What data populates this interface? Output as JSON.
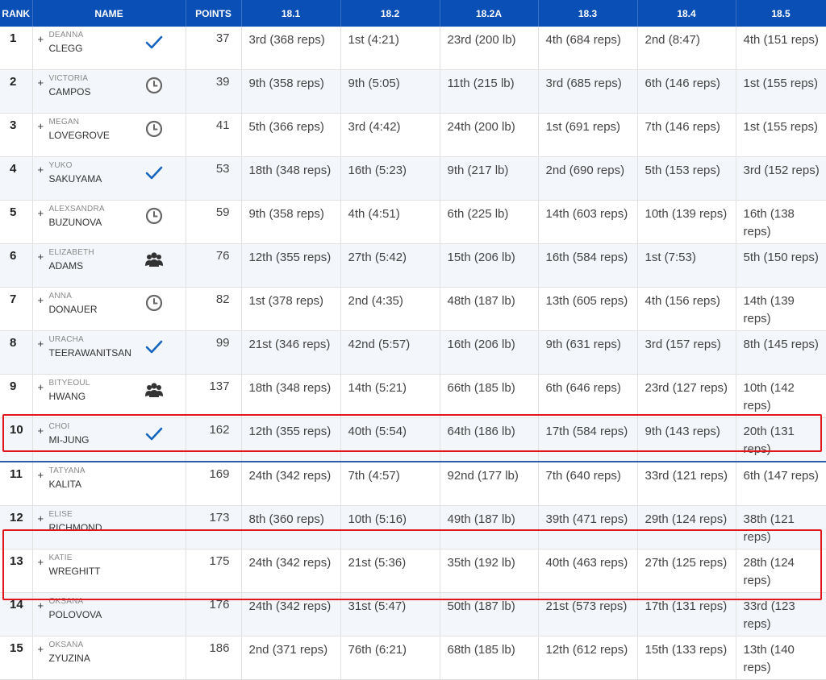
{
  "columns": {
    "rank": "RANK",
    "name": "NAME",
    "points": "POINTS",
    "e1": "18.1",
    "e2": "18.2",
    "e3": "18.2A",
    "e4": "18.3",
    "e5": "18.4",
    "e6": "18.5"
  },
  "colors": {
    "header_bg": "#0a4fb5",
    "highlight": "#e0161d",
    "icon_blue": "#1565c0"
  },
  "rows": [
    {
      "rank": "1",
      "first": "DEANNA",
      "last": "CLEGG",
      "status": "check-icon",
      "points": "37",
      "e1": "3rd (368 reps)",
      "e2": "1st (4:21)",
      "e3": "23rd (200 lb)",
      "e4": "4th (684 reps)",
      "e5": "2nd (8:47)",
      "e6": "4th (151 reps)"
    },
    {
      "rank": "2",
      "first": "VICTORIA",
      "last": "CAMPOS",
      "status": "clock-icon",
      "points": "39",
      "e1": "9th (358 reps)",
      "e2": "9th (5:05)",
      "e3": "11th (215 lb)",
      "e4": "3rd (685 reps)",
      "e5": "6th (146 reps)",
      "e6": "1st (155 reps)"
    },
    {
      "rank": "3",
      "first": "MEGAN",
      "last": "LOVEGROVE",
      "status": "clock-icon",
      "points": "41",
      "e1": "5th (366 reps)",
      "e2": "3rd (4:42)",
      "e3": "24th (200 lb)",
      "e4": "1st (691 reps)",
      "e5": "7th (146 reps)",
      "e6": "1st (155 reps)"
    },
    {
      "rank": "4",
      "first": "YUKO",
      "last": "SAKUYAMA",
      "status": "check-icon",
      "points": "53",
      "e1": "18th (348 reps)",
      "e2": "16th (5:23)",
      "e3": "9th (217 lb)",
      "e4": "2nd (690 reps)",
      "e5": "5th (153 reps)",
      "e6": "3rd (152 reps)"
    },
    {
      "rank": "5",
      "first": "ALEXSANDRA",
      "last": "BUZUNOVA",
      "status": "clock-icon",
      "points": "59",
      "e1": "9th (358 reps)",
      "e2": "4th (4:51)",
      "e3": "6th (225 lb)",
      "e4": "14th (603 reps)",
      "e5": "10th (139 reps)",
      "e6": "16th (138 reps)"
    },
    {
      "rank": "6",
      "first": "ELIZABETH",
      "last": "ADAMS",
      "status": "team-icon",
      "points": "76",
      "e1": "12th (355 reps)",
      "e2": "27th (5:42)",
      "e3": "15th (206 lb)",
      "e4": "16th (584 reps)",
      "e5": "1st (7:53)",
      "e6": "5th (150 reps)"
    },
    {
      "rank": "7",
      "first": "ANNA",
      "last": "DONAUER",
      "status": "clock-icon",
      "points": "82",
      "e1": "1st (378 reps)",
      "e2": "2nd (4:35)",
      "e3": "48th (187 lb)",
      "e4": "13th (605 reps)",
      "e5": "4th (156 reps)",
      "e6": "14th (139 reps)"
    },
    {
      "rank": "8",
      "first": "URACHA",
      "last": "TEERAWANITSAN",
      "status": "check-icon",
      "points": "99",
      "e1": "21st (346 reps)",
      "e2": "42nd (5:57)",
      "e3": "16th (206 lb)",
      "e4": "9th (631 reps)",
      "e5": "3rd (157 reps)",
      "e6": "8th (145 reps)"
    },
    {
      "rank": "9",
      "first": "BITYEOUL",
      "last": "HWANG",
      "status": "team-icon",
      "points": "137",
      "e1": "18th (348 reps)",
      "e2": "14th (5:21)",
      "e3": "66th (185 lb)",
      "e4": "6th (646 reps)",
      "e5": "23rd (127 reps)",
      "e6": "10th (142 reps)"
    },
    {
      "rank": "10",
      "first": "CHOI",
      "last": "MI-JUNG",
      "status": "check-icon",
      "points": "162",
      "e1": "12th (355 reps)",
      "e2": "40th (5:54)",
      "e3": "64th (186 lb)",
      "e4": "17th (584 reps)",
      "e5": "9th (143 reps)",
      "e6": "20th (131 reps)"
    },
    {
      "rank": "11",
      "first": "TATYANA",
      "last": "KALITA",
      "status": "",
      "points": "169",
      "e1": "24th (342 reps)",
      "e2": "7th (4:57)",
      "e3": "92nd (177 lb)",
      "e4": "7th (640 reps)",
      "e5": "33rd (121 reps)",
      "e6": "6th (147 reps)"
    },
    {
      "rank": "12",
      "first": "ELISE",
      "last": "RICHMOND",
      "status": "",
      "points": "173",
      "e1": "8th (360 reps)",
      "e2": "10th (5:16)",
      "e3": "49th (187 lb)",
      "e4": "39th (471 reps)",
      "e5": "29th (124 reps)",
      "e6": "38th (121 reps)"
    },
    {
      "rank": "13",
      "first": "KATIE",
      "last": "WREGHITT",
      "status": "",
      "points": "175",
      "e1": "24th (342 reps)",
      "e2": "21st (5:36)",
      "e3": "35th (192 lb)",
      "e4": "40th (463 reps)",
      "e5": "27th (125 reps)",
      "e6": "28th (124 reps)"
    },
    {
      "rank": "14",
      "first": "OKSANA",
      "last": "POLOVOVA",
      "status": "",
      "points": "176",
      "e1": "24th (342 reps)",
      "e2": "31st (5:47)",
      "e3": "50th (187 lb)",
      "e4": "21st (573 reps)",
      "e5": "17th (131 reps)",
      "e6": "33rd (123 reps)"
    },
    {
      "rank": "15",
      "first": "OKSANA",
      "last": "ZYUZINA",
      "status": "",
      "points": "186",
      "e1": "2nd (371 reps)",
      "e2": "76th (6:21)",
      "e3": "68th (185 lb)",
      "e4": "12th (612 reps)",
      "e5": "15th (133 reps)",
      "e6": "13th (140 reps)"
    }
  ]
}
